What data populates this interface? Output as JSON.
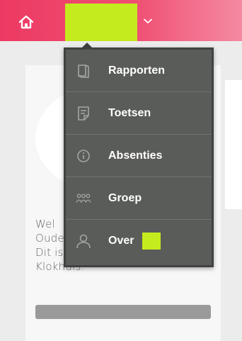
{
  "header": {
    "home_icon": "home-icon",
    "username_highlight_color": "#c4eb1e",
    "dropdown_toggle_icon": "chevron-down-icon",
    "bar_color": "#ec3a63"
  },
  "menu": {
    "items": [
      {
        "label": "Rapporten",
        "icon": "report-icon"
      },
      {
        "label": "Toetsen",
        "icon": "test-icon"
      },
      {
        "label": "Absenties",
        "icon": "info-icon"
      },
      {
        "label": "Groep",
        "icon": "group-icon"
      },
      {
        "label": "Over",
        "icon": "user-icon"
      }
    ]
  },
  "welcome": {
    "lines": [
      "Wel",
      "Oude",
      "Dit is het dashboard van Het",
      "Klokhuis."
    ]
  }
}
